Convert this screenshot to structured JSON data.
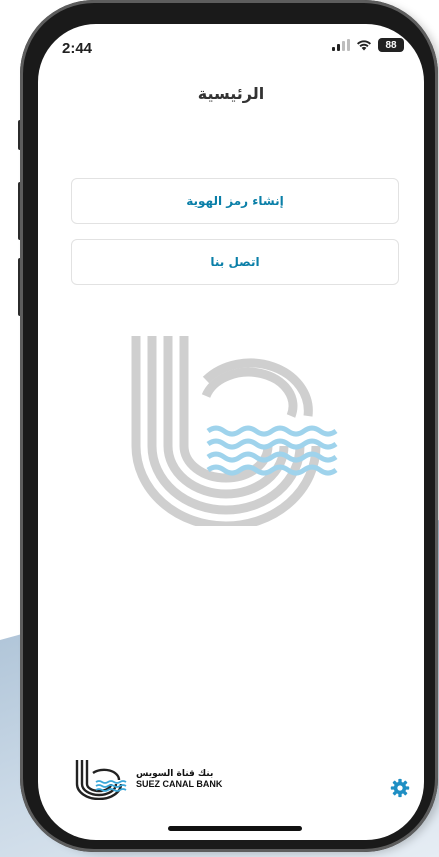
{
  "status_bar": {
    "time": "2:44",
    "battery": "88"
  },
  "header": {
    "title": "الرئيسية"
  },
  "menu": {
    "items": [
      {
        "label": "إنشاء رمز الهوية"
      },
      {
        "label": "اتصل بنا"
      }
    ]
  },
  "branding": {
    "arabic_name": "بنك قناة السويس",
    "english_name": "SUEZ CANAL BANK"
  },
  "colors": {
    "accent": "#0a7fa8",
    "logo_gray": "#cfcfcf",
    "logo_wave": "#9fd3ec"
  },
  "icons": {
    "settings": "gear-icon",
    "signal": "cellular-signal-icon",
    "wifi": "wifi-icon",
    "battery": "battery-icon"
  }
}
